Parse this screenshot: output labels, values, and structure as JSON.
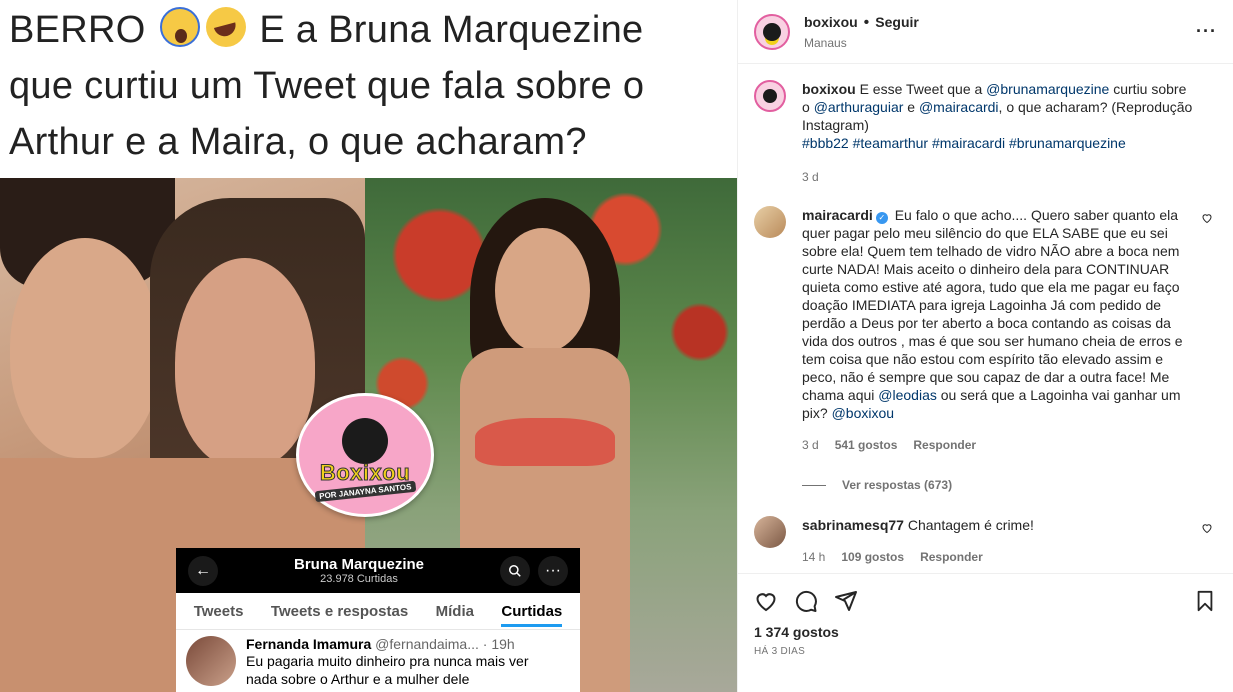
{
  "media": {
    "headline_line1_a": "BERRO",
    "headline_line1_b": "E a Bruna Marquezine",
    "headline_line2": "que curtiu um Tweet que fala sobre o",
    "headline_line3": "Arthur e a Maira, o que acharam?",
    "sticker": {
      "brand": "Boxixou",
      "byline": "POR JANAYNA SANTOS"
    },
    "twitter_card": {
      "profile_name": "Bruna Marquezine",
      "count": "23.978 Curtidas",
      "tabs": [
        "Tweets",
        "Tweets e respostas",
        "Mídia",
        "Curtidas"
      ],
      "post_author": "Fernanda Imamura",
      "post_handle": "@fernandaima...",
      "post_time": "· 19h",
      "post_text_1": "Eu pagaria muito dinheiro pra nunca mais ver",
      "post_text_2": "nada sobre o Arthur e a mulher dele"
    }
  },
  "header": {
    "username": "boxixou",
    "follow_label": "Seguir",
    "location": "Manaus",
    "more_label": "···"
  },
  "caption": {
    "username": "boxixou",
    "text_1": "E esse Tweet que a",
    "mention_1": "@brunamarquezine",
    "text_2": "curtiu sobre o",
    "mention_2": "@arthuraguiar",
    "text_3": "e",
    "mention_3": "@mairacardi",
    "text_4": ", o que acharam? (Reprodução Instagram)",
    "hashtags": "#bbb22 #teamarthur #mairacardi #brunamarquezine",
    "time": "3 d"
  },
  "comments": [
    {
      "username": "mairacardi",
      "text_a": "Eu falo o que acho....",
      "text_b": "Quero saber quanto ela quer pagar pelo meu silêncio do que ELA SABE que eu sei sobre ela! Quem tem telhado de vidro NÃO abre a boca nem curte NADA! Mais aceito o dinheiro dela para CONTINUAR quieta como estive até agora, tudo que ela me pagar eu faço doação IMEDIATA para igreja Lagoinha Já com pedido de perdão a Deus por ter aberto a boca contando as coisas da vida dos outros , mas é que sou ser humano cheia de erros e tem coisa que não estou com espírito tão elevado assim e peco, não é sempre que sou capaz de dar a outra face! Me chama aqui",
      "mention_a": "@leodias",
      "text_c": "ou será que a Lagoinha vai ganhar um pix?",
      "mention_b": "@boxixou",
      "time": "3 d",
      "likes": "541 gostos",
      "reply_label": "Responder",
      "view_replies": "Ver respostas (673)"
    },
    {
      "username": "sabrinamesq77",
      "text": "Chantagem é crime!",
      "time": "14 h",
      "likes": "109 gostos",
      "reply_label": "Responder"
    }
  ],
  "footer": {
    "likes_count": "1 374 gostos",
    "date": "HÁ 3 DIAS"
  }
}
